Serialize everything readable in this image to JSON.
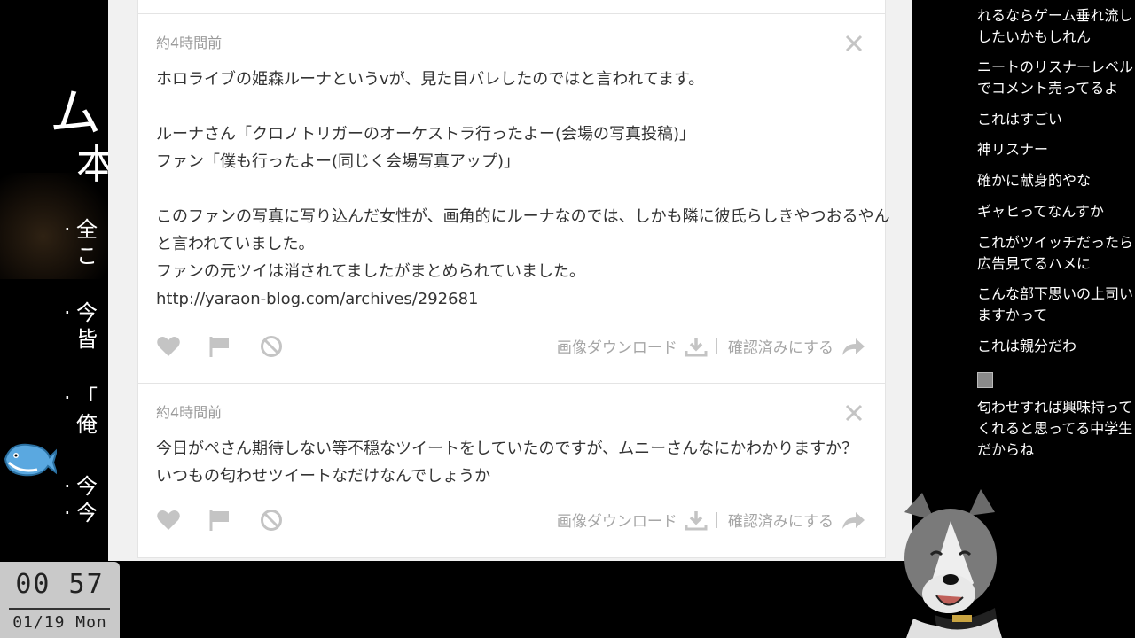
{
  "slide": {
    "heading": "ム",
    "heading2": "本",
    "bullets": [
      {
        "line1": "全",
        "line2": "こ"
      },
      {
        "line1": "今",
        "line2": "皆"
      },
      {
        "line1": "「",
        "line2": "俺"
      },
      {
        "line1": "今",
        "line2": ""
      },
      {
        "line1": "今",
        "line2": ""
      }
    ]
  },
  "clock": {
    "time": "00 57",
    "date": "01/19 Mon"
  },
  "posts": [
    {
      "time": "約4時間前",
      "lines": [
        "ホロライブの姫森ルーナというvが、見た目バレしたのではと言われてます。",
        "",
        "ルーナさん「クロノトリガーのオーケストラ行ったよー(会場の写真投稿)」",
        "ファン「僕も行ったよー(同じく会場写真アップ)」",
        "",
        "このファンの写真に写り込んだ女性が、画角的にルーナなのでは、しかも隣に彼氏らしきやつおるやん",
        "と言われていました。",
        "ファンの元ツイは消されてましたがまとめられていました。",
        "http://yaraon-blog.com/archives/292681"
      ],
      "download_label": "画像ダウンロード",
      "confirm_label": "確認済みにする"
    },
    {
      "time": "約4時間前",
      "lines": [
        "今日がぺさん期待しない等不穏なツイートをしていたのですが、ムニーさんなにかわかりますか？",
        "いつもの匂わせツイートなだけなんでしょうか"
      ],
      "download_label": "画像ダウンロード",
      "confirm_label": "確認済みにする"
    }
  ],
  "chat": [
    "れるならゲーム垂れ流し",
    "したいかもしれん",
    "ニートのリスナーレベル",
    "でコメント売ってるよ",
    "これはすごい",
    "神リスナー",
    "確かに献身的やな",
    "ギャヒってなんすか",
    "これがツイッチだったら",
    "広告見てるハメに",
    "こんな部下思いの上司い",
    "ますかって",
    "これは親分だわ",
    "匂わせすれば興味持って",
    "くれると思ってる中学生",
    "だからね"
  ],
  "icons": {
    "like": "heart-icon",
    "report": "flag-icon",
    "block": "ban-icon",
    "download": "download-icon",
    "confirm": "share-arrow-icon",
    "close": "close-icon"
  },
  "colors": {
    "panel_bg": "#f1f1f1",
    "card_bg": "#ffffff",
    "text": "#333333",
    "muted": "#9a9a9a",
    "icon": "#c4c4c4"
  }
}
